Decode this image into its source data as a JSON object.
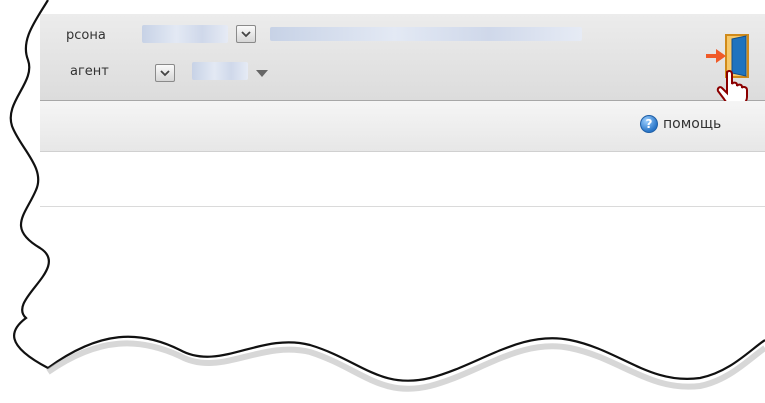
{
  "header": {
    "persona_label": "рсона",
    "agent_label": "агент"
  },
  "toolbar": {
    "help_label": "помощь"
  },
  "icons": {
    "logout": "exit-door-icon",
    "help": "help-icon",
    "cursor": "hand-pointer-icon",
    "dropdown": "chevron-down-icon"
  },
  "colors": {
    "accent_blue": "#2a76c8",
    "logout_orange": "#f0a030"
  }
}
